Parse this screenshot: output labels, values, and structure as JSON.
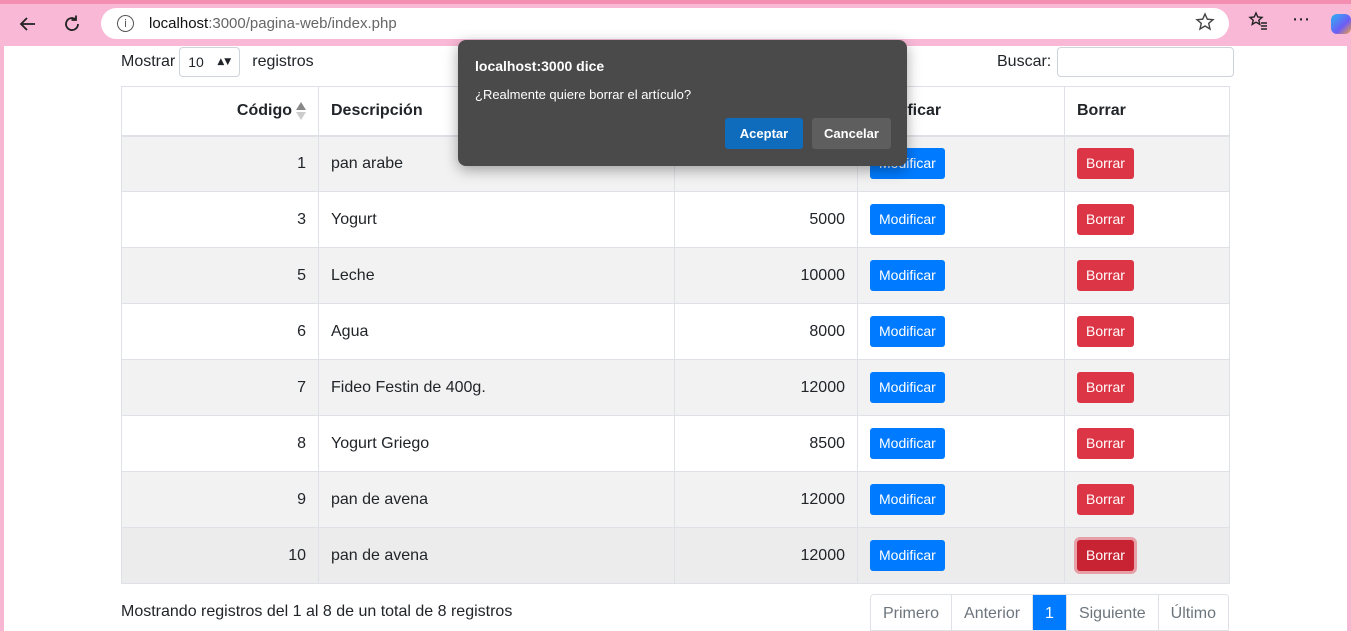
{
  "browser": {
    "url_host": "localhost",
    "url_path": ":3000/pagina-web/index.php"
  },
  "controls": {
    "show_label": "Mostrar",
    "show_value": "10",
    "records_label": "registros",
    "search_label": "Buscar:",
    "search_value": ""
  },
  "table": {
    "headers": [
      "Código",
      "Descripción",
      "",
      "Modificar",
      "Borrar"
    ],
    "rows": [
      {
        "codigo": "1",
        "descripcion": "pan arabe",
        "precio": ""
      },
      {
        "codigo": "3",
        "descripcion": "Yogurt",
        "precio": "5000"
      },
      {
        "codigo": "5",
        "descripcion": "Leche",
        "precio": "10000"
      },
      {
        "codigo": "6",
        "descripcion": "Agua",
        "precio": "8000"
      },
      {
        "codigo": "7",
        "descripcion": "Fideo Festin de 400g.",
        "precio": "12000"
      },
      {
        "codigo": "8",
        "descripcion": "Yogurt Griego",
        "precio": "8500"
      },
      {
        "codigo": "9",
        "descripcion": "pan de avena",
        "precio": "12000"
      },
      {
        "codigo": "10",
        "descripcion": "pan de avena",
        "precio": "12000"
      }
    ],
    "modify_label": "Modificar",
    "delete_label": "Borrar"
  },
  "footer": {
    "info": "Mostrando registros del 1 al 8 de un total de 8 registros",
    "pager": [
      "Primero",
      "Anterior",
      "1",
      "Siguiente",
      "Último"
    ]
  },
  "dialog": {
    "title": "localhost:3000 dice",
    "message": "¿Realmente quiere borrar el artículo?",
    "ok_label": "Aceptar",
    "cancel_label": "Cancelar"
  },
  "colors": {
    "primary": "#007bff",
    "danger": "#dc3545",
    "chrome": "#f9b9d6",
    "dialog_bg": "#4a4a4a",
    "dialog_ok": "#0f6cbd"
  },
  "icons": [
    "back-arrow-icon",
    "reload-icon",
    "info-icon",
    "star-icon",
    "favorites-icon",
    "more-icon",
    "copilot-icon",
    "sort-icon"
  ]
}
